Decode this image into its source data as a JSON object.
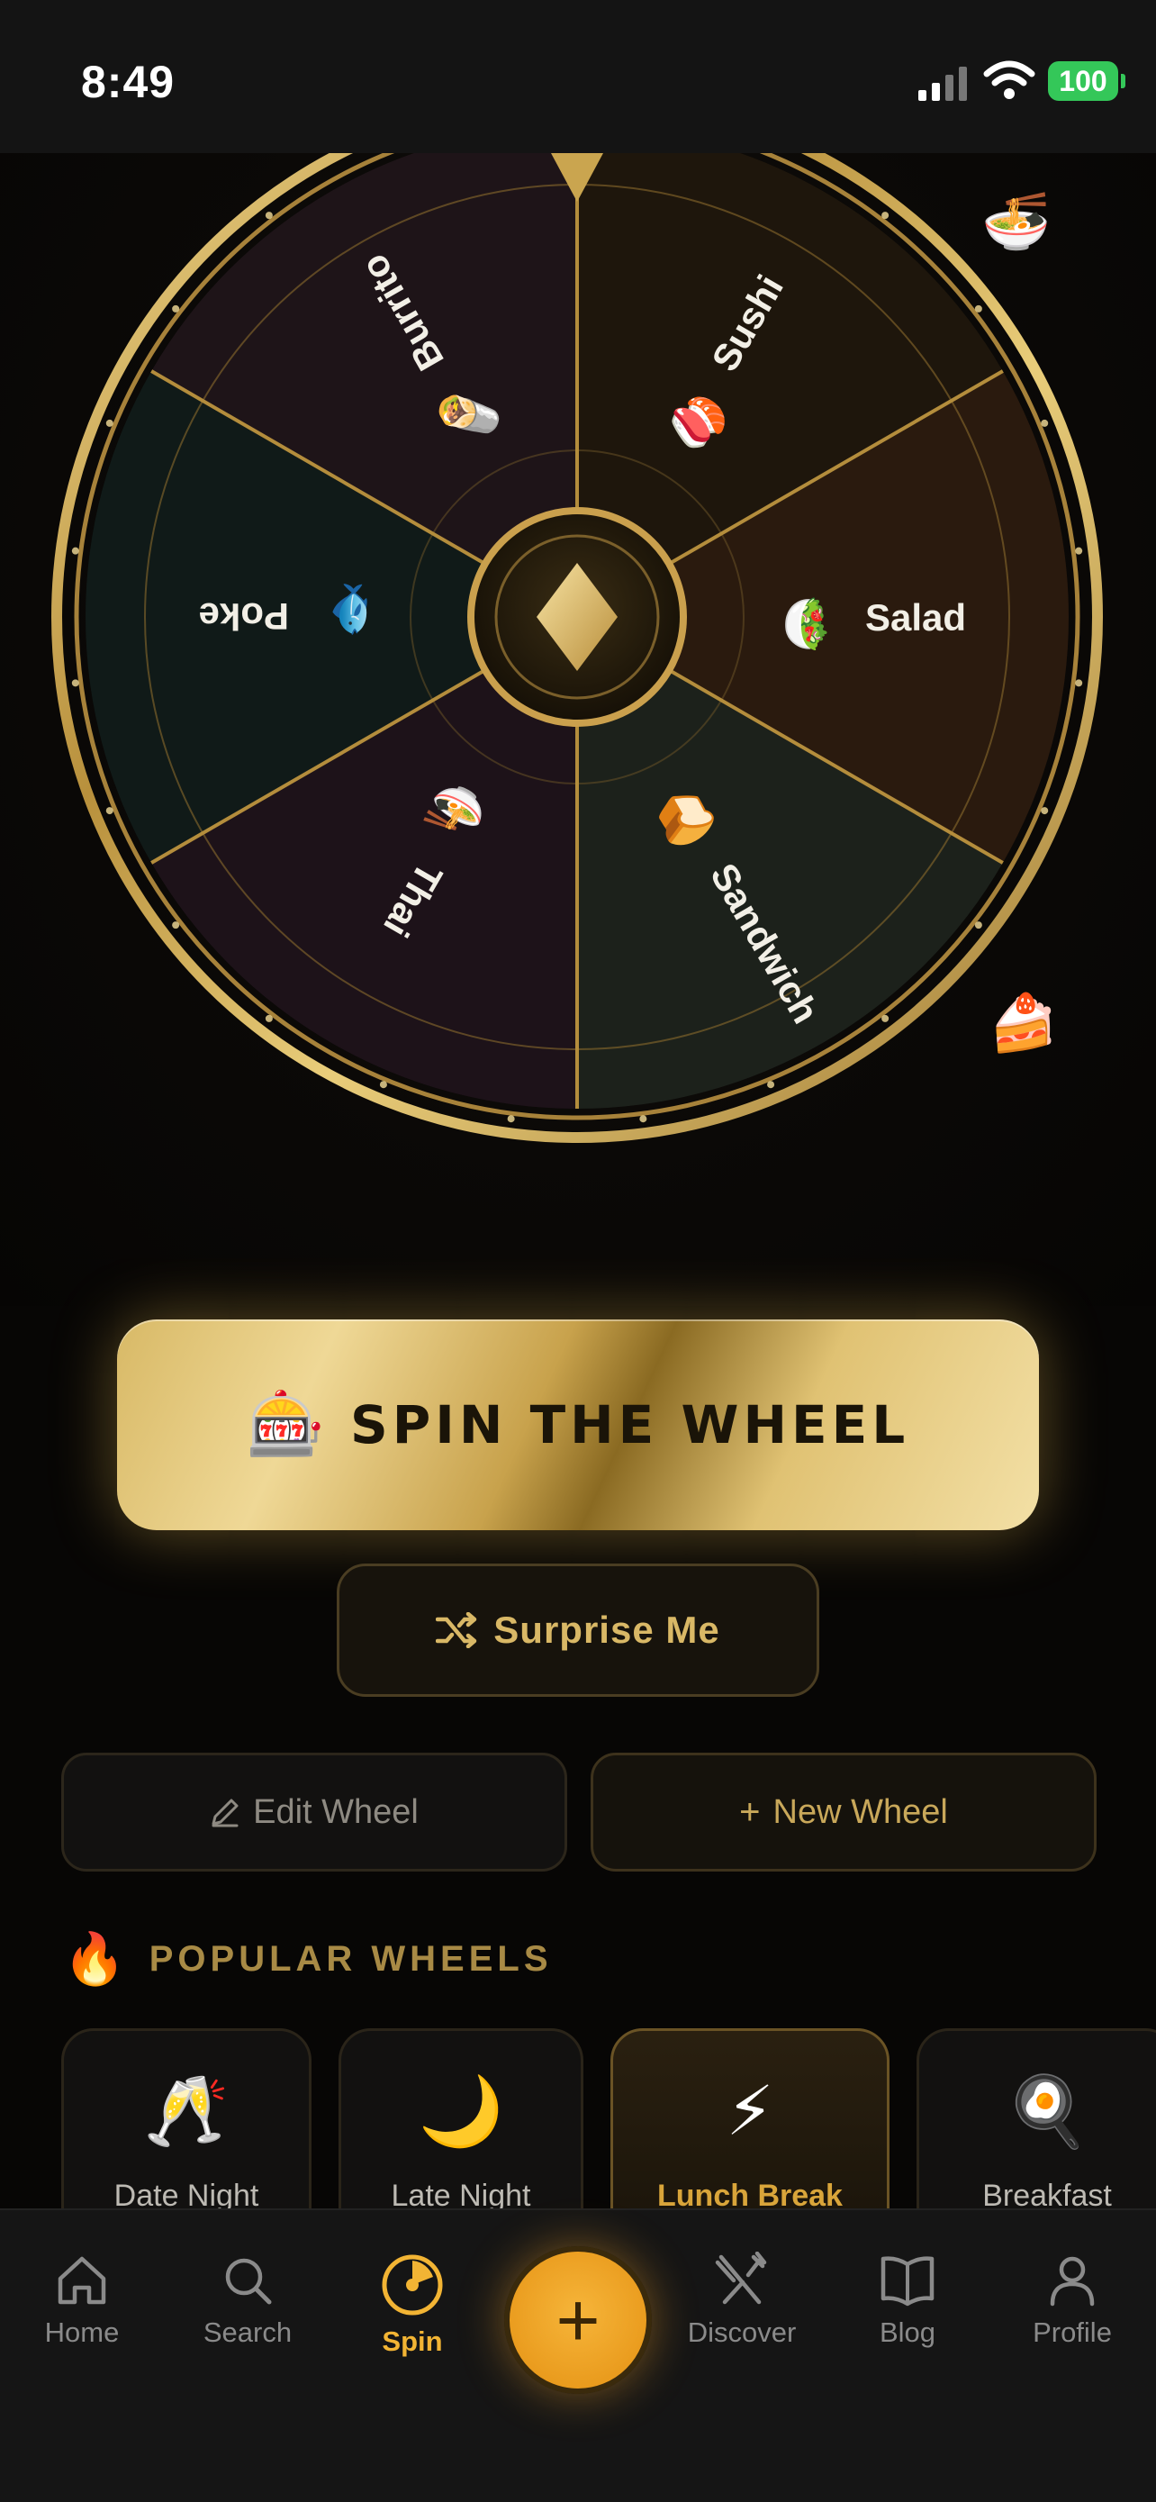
{
  "status_bar": {
    "time": "8:49",
    "battery": "100"
  },
  "wheel": {
    "segments": [
      {
        "label": "Sushi",
        "emoji": "🍣"
      },
      {
        "label": "Salad",
        "emoji": "🥗"
      },
      {
        "label": "Sandwich",
        "emoji": "🍞"
      },
      {
        "label": "Thai",
        "emoji": "🍜"
      },
      {
        "label": "Poke",
        "emoji": "🐟"
      },
      {
        "label": "Burrito",
        "emoji": "🌯"
      }
    ],
    "floating_emojis": [
      "🍜",
      "🍰"
    ]
  },
  "actions": {
    "spin_icon": "🎰",
    "spin_label": "SPIN THE WHEEL",
    "surprise_label": "Surprise Me",
    "edit_label": "Edit Wheel",
    "new_label": "New Wheel"
  },
  "popular": {
    "icon": "🔥",
    "title": "POPULAR WHEELS",
    "items": [
      {
        "emoji": "🥂",
        "name": "Date Night"
      },
      {
        "emoji": "🌙",
        "name": "Late Night"
      },
      {
        "emoji": "⚡",
        "name": "Lunch Break"
      },
      {
        "emoji": "🍳",
        "name": "Breakfast"
      }
    ]
  },
  "tabbar": {
    "tabs": [
      {
        "label": "Home",
        "icon": "home-icon"
      },
      {
        "label": "Search",
        "icon": "search-icon"
      },
      {
        "label": "Spin",
        "icon": "spin-icon"
      },
      {
        "label": "Discover",
        "icon": "utensils-icon"
      },
      {
        "label": "Blog",
        "icon": "book-icon"
      },
      {
        "label": "Profile",
        "icon": "profile-icon"
      }
    ],
    "fab_label": "+"
  },
  "colors": {
    "gold": "#d4af37",
    "accent": "#f2b434",
    "battery": "#34c759"
  }
}
